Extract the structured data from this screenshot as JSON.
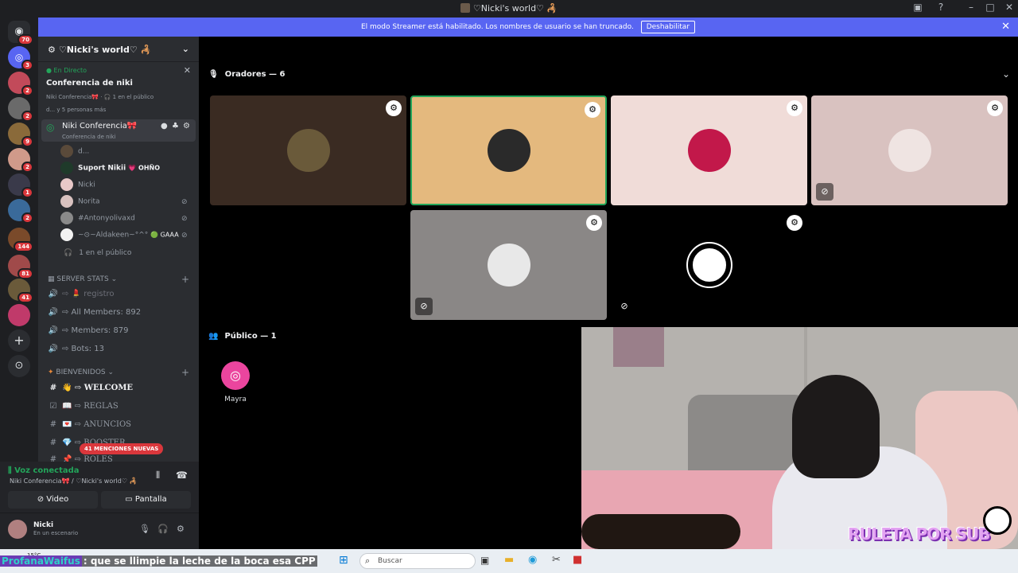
{
  "window": {
    "title": "♡Nicki's world♡ 🦂"
  },
  "banner": {
    "text": "El modo Streamer está habilitado. Los nombres de usuario se han truncado.",
    "button": "Deshabilitar"
  },
  "guild_badges": [
    "70",
    "3",
    "2",
    "2",
    "9",
    "2",
    "1",
    "2",
    "144",
    "81",
    "41"
  ],
  "server": {
    "name": "♡Nicki's world♡ 🦂"
  },
  "live": {
    "tag": "En Directo",
    "title": "Conferencia de niki",
    "meta": "Niki Conferencia🎀 · 🎧 1 en el público",
    "others": "d... y 5 personas más"
  },
  "stage_channel": {
    "name": "Niki Conferencia🎀",
    "topic": "Conferencia de niki"
  },
  "stage_users": [
    {
      "name": "d..."
    },
    {
      "name": "Suport Nikii",
      "tag": "💗 OHÑO"
    },
    {
      "name": "Nicki"
    },
    {
      "name": "Norita"
    },
    {
      "name": "#Antonyolivaxd"
    },
    {
      "name": "~⊙~Aldakeen~°^°",
      "tag": "🟢 GAAA"
    }
  ],
  "audience_row": "1 en el público",
  "categories": [
    {
      "name": "SERVER STATS",
      "channels": [
        "⇨ 💄 registro",
        "⇨ All Members: 892",
        "⇨ Members: 879",
        "⇨ Bots: 13"
      ]
    },
    {
      "name": "BIENVENIDOS",
      "channels": [
        "👋 ⇨ WELCOME",
        "📖 ⇨ REGLAS",
        "💌 ⇨ ANUNCIOS",
        "💎 ⇨ BOOSTER",
        "📌 ⇨ ROLES"
      ]
    }
  ],
  "mentions_pill": "41 MENCIONES NUEVAS",
  "voice": {
    "status": "Voz conectada",
    "channel": "Niki Conferencia🎀 / ♡Nicki's world♡ 🦂",
    "video": "Video",
    "screen": "Pantalla"
  },
  "user": {
    "name": "Nicki",
    "status": "En un escenario"
  },
  "speakers_header": "Oradores — 6",
  "audience_header": "Público — 1",
  "audience_member": "Mayra",
  "taskbar": {
    "temp": "15°C",
    "search": "Buscar"
  },
  "overlay": {
    "user": "ProfanaWaifus",
    "message": ": que se llimpie la leche de la boca esa CPP",
    "camera_text": "RULETA POR SUB"
  },
  "colors": {
    "accent": "#5865f2",
    "live_green": "#23a55a",
    "mention_red": "#da373c"
  }
}
